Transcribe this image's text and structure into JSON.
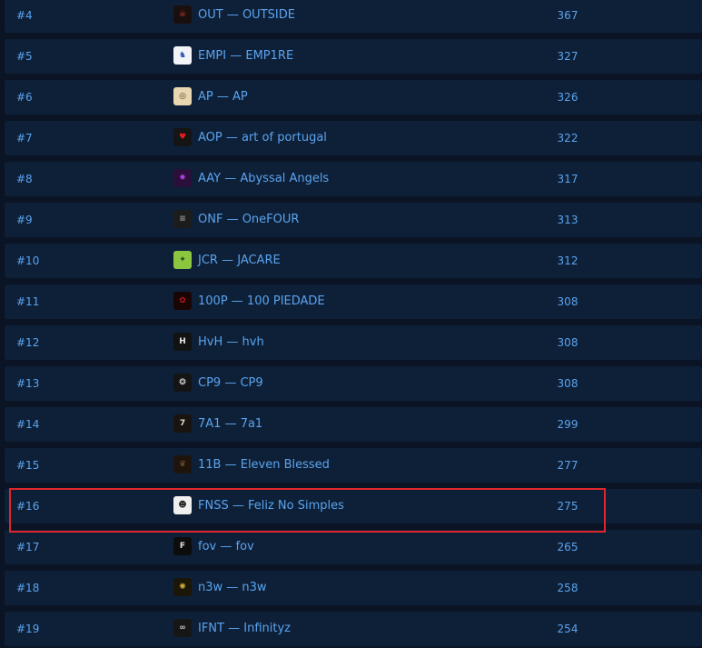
{
  "colors": {
    "background": "#0a1424",
    "row": "#0e2038",
    "text": "#5aa3ee",
    "highlight": "#e0262c"
  },
  "rows": [
    {
      "rank": "#4",
      "team": "OUT — OUTSIDE",
      "points": "367",
      "logo_icon": "outside-logo-icon",
      "logo_bg": "#1a0f0f",
      "logo_fg": "#d23a2a",
      "logo_glyph": "☠"
    },
    {
      "rank": "#5",
      "team": "EMPI — EMP1RE",
      "points": "327",
      "logo_icon": "empire-logo-icon",
      "logo_bg": "#f2f4f8",
      "logo_fg": "#2b4fb8",
      "logo_glyph": "♞"
    },
    {
      "rank": "#6",
      "team": "AP — AP",
      "points": "326",
      "logo_icon": "ap-logo-icon",
      "logo_bg": "#e8d6b0",
      "logo_fg": "#5a3a1a",
      "logo_glyph": "◎"
    },
    {
      "rank": "#7",
      "team": "AOP — art of portugal",
      "points": "322",
      "logo_icon": "aop-logo-icon",
      "logo_bg": "#151515",
      "logo_fg": "#e02020",
      "logo_glyph": "♥"
    },
    {
      "rank": "#8",
      "team": "AAY — Abyssal Angels",
      "points": "317",
      "logo_icon": "aay-logo-icon",
      "logo_bg": "#2a0f3a",
      "logo_fg": "#b040e0",
      "logo_glyph": "✸"
    },
    {
      "rank": "#9",
      "team": "ONF — OneFOUR",
      "points": "313",
      "logo_icon": "onefour-logo-icon",
      "logo_bg": "#1c1c1c",
      "logo_fg": "#9a9a9a",
      "logo_glyph": "≡"
    },
    {
      "rank": "#10",
      "team": "JCR — JACARE",
      "points": "312",
      "logo_icon": "jacare-logo-icon",
      "logo_bg": "#8cc63f",
      "logo_fg": "#1e4d1a",
      "logo_glyph": "✦"
    },
    {
      "rank": "#11",
      "team": "100P — 100 PIEDADE",
      "points": "308",
      "logo_icon": "piedade-logo-icon",
      "logo_bg": "#1a0505",
      "logo_fg": "#c0151e",
      "logo_glyph": "✿"
    },
    {
      "rank": "#12",
      "team": "HvH — hvh",
      "points": "308",
      "logo_icon": "hvh-logo-icon",
      "logo_bg": "#121212",
      "logo_fg": "#e6e6e6",
      "logo_glyph": "H"
    },
    {
      "rank": "#13",
      "team": "CP9 — CP9",
      "points": "308",
      "logo_icon": "cp9-logo-icon",
      "logo_bg": "#141414",
      "logo_fg": "#e6e6e6",
      "logo_glyph": "❂"
    },
    {
      "rank": "#14",
      "team": "7A1 — 7a1",
      "points": "299",
      "logo_icon": "7a1-logo-icon",
      "logo_bg": "#1a1410",
      "logo_fg": "#e8d8c0",
      "logo_glyph": "7"
    },
    {
      "rank": "#15",
      "team": "11B — Eleven Blessed",
      "points": "277",
      "logo_icon": "eleven-blessed-logo-icon",
      "logo_bg": "#1e140c",
      "logo_fg": "#7a5530",
      "logo_glyph": "♛"
    },
    {
      "rank": "#16",
      "team": "FNSS — Feliz No Simples",
      "points": "275",
      "logo_icon": "fnss-logo-icon",
      "logo_bg": "#f0f0f0",
      "logo_fg": "#222222",
      "logo_glyph": "☻"
    },
    {
      "rank": "#17",
      "team": "fov — fov",
      "points": "265",
      "logo_icon": "fov-logo-icon",
      "logo_bg": "#0c0c0c",
      "logo_fg": "#e0e0e0",
      "logo_glyph": "F"
    },
    {
      "rank": "#18",
      "team": "n3w — n3w",
      "points": "258",
      "logo_icon": "n3w-logo-icon",
      "logo_bg": "#1a1608",
      "logo_fg": "#d4b040",
      "logo_glyph": "✺"
    },
    {
      "rank": "#19",
      "team": "IFNT — Infinityz",
      "points": "254",
      "logo_icon": "infinityz-logo-icon",
      "logo_bg": "#161616",
      "logo_fg": "#c8c8c8",
      "logo_glyph": "∞"
    }
  ],
  "highlighted_rank": "#16"
}
